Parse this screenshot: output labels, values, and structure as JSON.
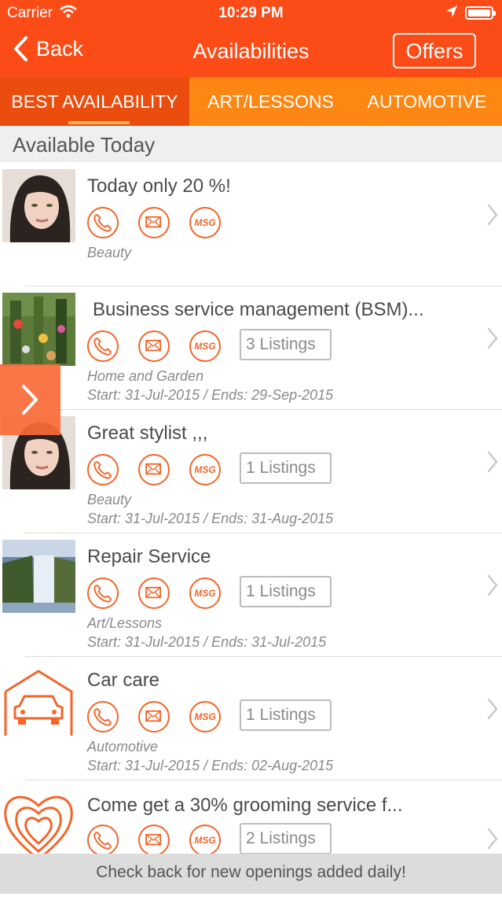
{
  "status": {
    "carrier": "Carrier",
    "time": "10:29 PM"
  },
  "nav": {
    "back_label": "Back",
    "title": "Availabilities",
    "offers_label": "Offers"
  },
  "tabs": [
    {
      "label": "BEST AVAILABILITY"
    },
    {
      "label": "ART/LESSONS"
    },
    {
      "label": "AUTOMOTIVE"
    }
  ],
  "section_header": "Available Today",
  "msg_label": "MSG",
  "items": [
    {
      "title": "Today only 20 %!",
      "category": "Beauty",
      "listings": "",
      "dates": ""
    },
    {
      "title": "Business service management (BSM)...",
      "category": "Home and Garden",
      "listings": "3 Listings",
      "dates": "Start: 31-Jul-2015 / Ends: 29-Sep-2015"
    },
    {
      "title": "Great stylist ,,,",
      "category": "Beauty",
      "listings": "1 Listings",
      "dates": "Start: 31-Jul-2015 / Ends: 31-Aug-2015"
    },
    {
      "title": "Repair Service",
      "category": "Art/Lessons",
      "listings": "1 Listings",
      "dates": "Start: 31-Jul-2015 / Ends: 31-Jul-2015"
    },
    {
      "title": "Car care",
      "category": "Automotive",
      "listings": "1 Listings",
      "dates": "Start: 31-Jul-2015 / Ends: 02-Aug-2015"
    },
    {
      "title": "Come get a 30% grooming service f...",
      "category": "",
      "listings": "2 Listings",
      "dates": ""
    }
  ],
  "footer": "Check back for new openings added daily!",
  "colors": {
    "nav_orange": "#fb4b17",
    "tab_orange": "#fd8712",
    "active_tab": "#eb4d0e",
    "accent": "#f2662a"
  }
}
